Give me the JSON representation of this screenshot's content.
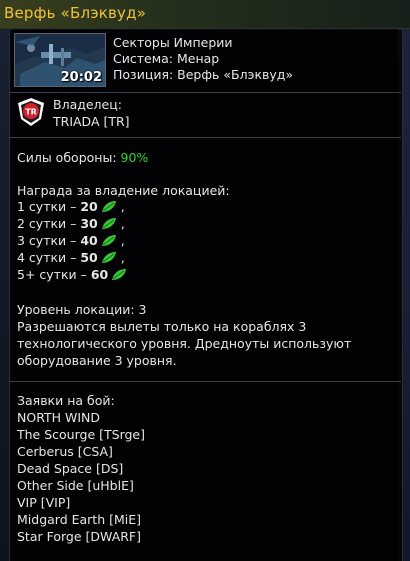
{
  "window": {
    "title": "Верфь «Блэквуд»"
  },
  "location": {
    "thumbnail_time": "20:02",
    "sector": "Секторы Империи",
    "system": "Система: Менар",
    "position": "Позиция: Верфь «Блэквуд»"
  },
  "owner": {
    "label": "Владелец:",
    "name": "TRIADA [TR]",
    "emblem_icon": "triada-corp-emblem-icon"
  },
  "defense": {
    "label": "Силы обороны:",
    "value": "90%",
    "value_color": "#2ed62e"
  },
  "reward": {
    "heading": "Награда за владение локацией:",
    "currency_icon": "green-leaf-icon",
    "rows": [
      {
        "period": "1 сутки –",
        "amount": "20",
        "suffix": ","
      },
      {
        "period": "2 сутки –",
        "amount": "30",
        "suffix": ","
      },
      {
        "period": "3 сутки –",
        "amount": "40",
        "suffix": ","
      },
      {
        "period": "4 сутки –",
        "amount": "50",
        "suffix": ","
      },
      {
        "period": "5+ сутки –",
        "amount": "60",
        "suffix": ""
      }
    ]
  },
  "level": {
    "label": "Уровень локации: 3",
    "description_lines": [
      "Разрешаются вылеты только на кораблях 3",
      "технологического уровня. Дредноуты используют",
      "оборудование 3 уровня."
    ]
  },
  "battle": {
    "heading": "Заявки на бой:",
    "applicants": [
      "NORTH WIND",
      "The Scourge [TSrge]",
      "Cerberus [CSA]",
      "Dead Space [DS]",
      "Other Side [uHblE]",
      "VIP [VIP]",
      "Midgard Earth [MiE]",
      "Star Forge [DWARF]"
    ]
  },
  "colors": {
    "title": "#f0c23a",
    "accent_green": "#2ed62e"
  }
}
